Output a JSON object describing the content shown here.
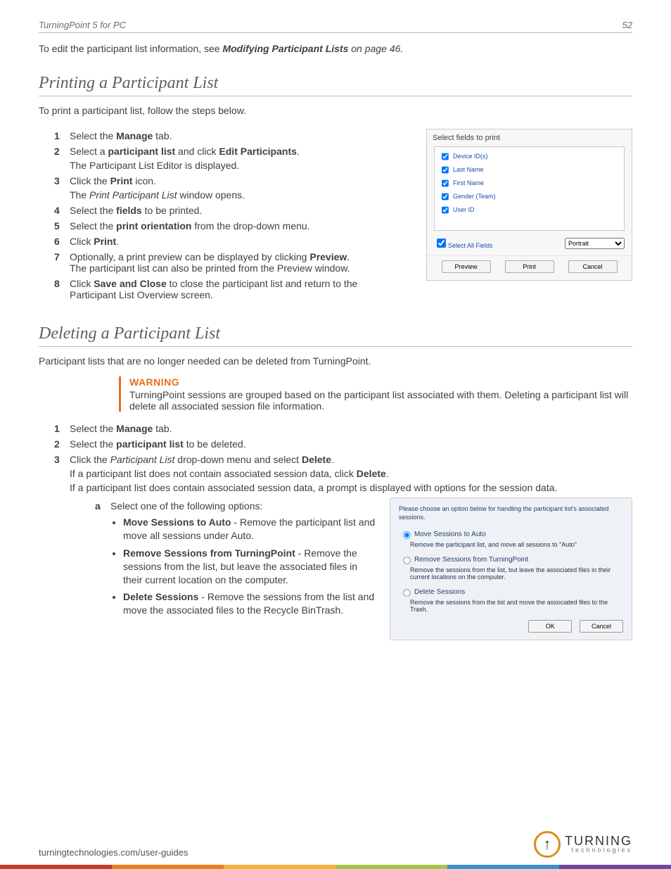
{
  "header": {
    "title": "TurningPoint 5 for PC",
    "page": "52"
  },
  "intro": {
    "pre": "To edit the participant list information, see ",
    "ref": "Modifying Participant Lists",
    "post": " on page 46."
  },
  "print_section": {
    "heading": "Printing a Participant List",
    "lead": "To print a participant list, follow the steps below.",
    "steps": {
      "s1": {
        "num": "1",
        "a": "Select the ",
        "b": "Manage",
        "c": " tab."
      },
      "s2": {
        "num": "2",
        "a": "Select a ",
        "b": "participant list",
        "c": " and click ",
        "d": "Edit Participants",
        "e": ".",
        "sub": "The Participant List Editor is displayed."
      },
      "s3": {
        "num": "3",
        "a": "Click the ",
        "b": "Print",
        "c": " icon.",
        "sub_a": "The ",
        "sub_i": "Print Participant List",
        "sub_b": " window opens."
      },
      "s4": {
        "num": "4",
        "a": "Select the ",
        "b": "fields",
        "c": " to be printed."
      },
      "s5": {
        "num": "5",
        "a": "Select the ",
        "b": "print orientation",
        "c": " from the drop-down menu."
      },
      "s6": {
        "num": "6",
        "a": "Click ",
        "b": "Print",
        "c": "."
      },
      "s7": {
        "num": "7",
        "a": "Optionally, a print preview can be displayed by clicking ",
        "b": "Preview",
        "c": ". The participant list can also be printed from the Preview window."
      },
      "s8": {
        "num": "8",
        "a": "Click ",
        "b": "Save and Close",
        "c": " to close the participant list and return to the Participant List Overview screen."
      }
    }
  },
  "print_dialog": {
    "title": "Select fields to print",
    "fields": [
      "Device ID(s)",
      "Last Name",
      "First Name",
      "Gender (Team)",
      "User ID"
    ],
    "select_all": "Select All Fields",
    "orientation": "Portrait",
    "buttons": {
      "preview": "Preview",
      "print": "Print",
      "cancel": "Cancel"
    }
  },
  "delete_section": {
    "heading": "Deleting a Participant List",
    "lead": "Participant lists that are no longer needed can be deleted from TurningPoint.",
    "warning": {
      "title": "WARNING",
      "body": "TurningPoint sessions are grouped based on the participant list associated with them. Deleting a participant list will delete all associated session file information."
    },
    "steps": {
      "s1": {
        "num": "1",
        "a": "Select the ",
        "b": "Manage",
        "c": " tab."
      },
      "s2": {
        "num": "2",
        "a": "Select the ",
        "b": "participant list",
        "c": " to be deleted."
      },
      "s3": {
        "num": "3",
        "a": "Click the ",
        "i": "Participant List",
        "b": " drop-down menu and select ",
        "c": "Delete",
        "d": ".",
        "l1a": "If a participant list does not contain associated session data, click ",
        "l1b": "Delete",
        "l1c": ".",
        "l2": "If a participant list does contain associated session data, a prompt is displayed with options for the session data."
      }
    },
    "sub_a": {
      "label": "a",
      "text": "Select one of the following options:"
    },
    "options": {
      "o1": {
        "t": "Move Sessions to Auto",
        "d": " - Remove the participant list and move all sessions under Auto."
      },
      "o2": {
        "t": "Remove Sessions from TurningPoint",
        "d": " - Remove the sessions from the list, but leave the associated files in their current location on the computer."
      },
      "o3": {
        "t": "Delete Sessions",
        "d": " - Remove the sessions from the list and move the associated files to the Recycle BinTrash."
      }
    }
  },
  "sessions_dialog": {
    "prompt": "Please choose an option below for handling the participant list's associated sessions.",
    "o1": {
      "t": "Move Sessions to Auto",
      "d": "Remove the participant list, and move all sessions to \"Auto\""
    },
    "o2": {
      "t": "Remove Sessions from TurningPoint",
      "d": "Remove the sessions from the list, but leave the associated files in their current locations on the computer."
    },
    "o3": {
      "t": "Delete Sessions",
      "d": "Remove the sessions from the list and move the associated files to the Trash."
    },
    "ok": "OK",
    "cancel": "Cancel"
  },
  "footer": {
    "url": "turningtechnologies.com/user-guides",
    "logo1": "TURNING",
    "logo2": "technologies"
  }
}
